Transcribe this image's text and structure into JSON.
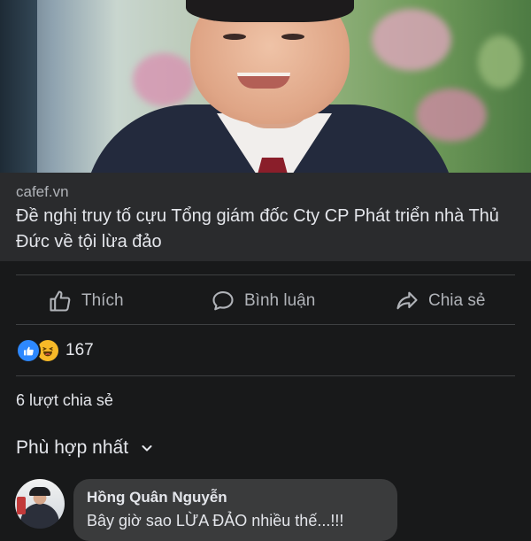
{
  "post": {
    "link": {
      "domain": "cafef.vn",
      "title": "Đề nghị truy tố cựu Tổng giám đốc Cty CP Phát triển nhà Thủ Đức về tội lừa đảo"
    }
  },
  "actions": {
    "like_label": "Thích",
    "comment_label": "Bình luận",
    "share_label": "Chia sẻ"
  },
  "reactions": {
    "icons": [
      "like-icon",
      "haha-icon"
    ],
    "count": "167"
  },
  "shares_text": "6 lượt chia sẻ",
  "comments_sort": {
    "label": "Phù hợp nhất"
  },
  "comments": [
    {
      "author": "Hồng Quân Nguyễn",
      "text": "Bây giờ sao LỪA ĐẢO nhiều thế...!!!"
    }
  ],
  "colors": {
    "background": "#18191a",
    "link_box": "#2a2b2d",
    "comment_bubble": "#3a3b3c",
    "like_blue": "#2d88ff",
    "haha_yellow": "#f7b928",
    "muted_text": "#b0b3b8"
  }
}
